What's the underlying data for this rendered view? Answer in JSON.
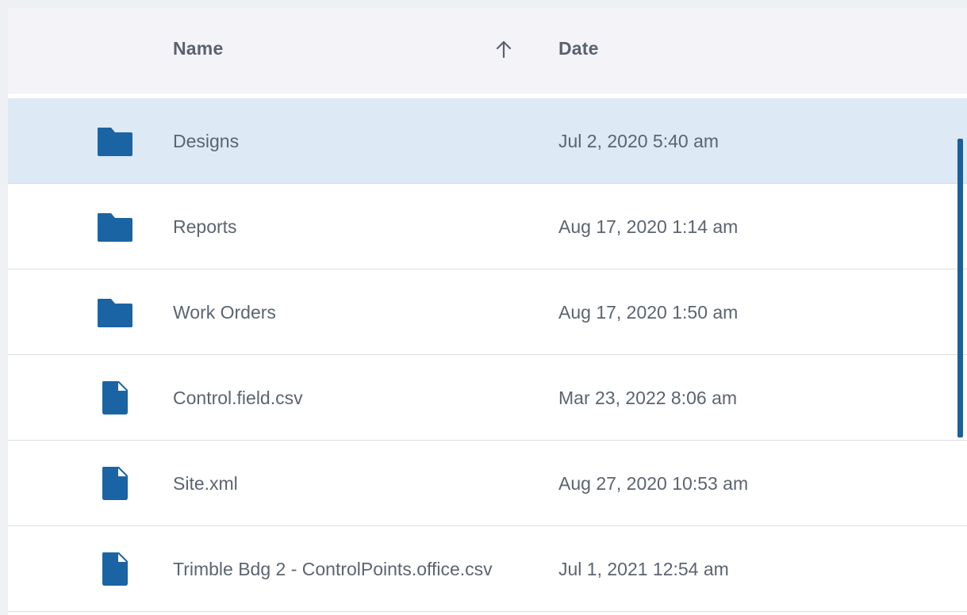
{
  "header": {
    "name_label": "Name",
    "date_label": "Date",
    "sort_icon": "arrow-up-icon"
  },
  "colors": {
    "accent": "#1b64a3",
    "selected_row": "#dde9f4",
    "header_bg": "#f4f4f8"
  },
  "files": [
    {
      "type": "folder",
      "icon": "folder-icon",
      "name": "Designs",
      "date": "Jul 2, 2020 5:40 am",
      "selected": true
    },
    {
      "type": "folder",
      "icon": "folder-icon",
      "name": "Reports",
      "date": "Aug 17, 2020 1:14 am",
      "selected": false
    },
    {
      "type": "folder",
      "icon": "folder-icon",
      "name": "Work Orders",
      "date": "Aug 17, 2020 1:50 am",
      "selected": false
    },
    {
      "type": "file",
      "icon": "file-icon",
      "name": "Control.field.csv",
      "date": "Mar 23, 2022 8:06 am",
      "selected": false
    },
    {
      "type": "file",
      "icon": "file-icon",
      "name": "Site.xml",
      "date": "Aug 27, 2020 10:53 am",
      "selected": false
    },
    {
      "type": "file",
      "icon": "file-icon",
      "name": "Trimble Bdg 2 - ControlPoints.office.csv",
      "date": "Jul 1, 2021 12:54 am",
      "selected": false
    }
  ]
}
